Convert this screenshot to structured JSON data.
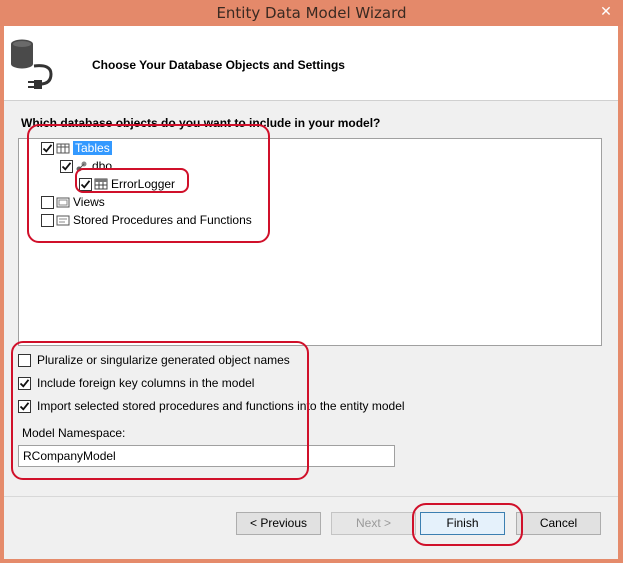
{
  "window": {
    "title": "Entity Data Model Wizard",
    "close_glyph": "✕"
  },
  "header": {
    "title": "Choose Your Database Objects and Settings",
    "icon": "database-plug-icon"
  },
  "question": "Which database objects do you want to include in your model?",
  "tree": {
    "tables": {
      "label": "Tables",
      "checked": true,
      "selected": true,
      "icon": "table-folder-icon"
    },
    "dbo": {
      "label": "dbo",
      "checked": true,
      "icon": "schema-icon"
    },
    "errorlogger": {
      "label": "ErrorLogger",
      "checked": true,
      "icon": "table-icon"
    },
    "views": {
      "label": "Views",
      "checked": false,
      "icon": "view-folder-icon"
    },
    "procs": {
      "label": "Stored Procedures and Functions",
      "checked": false,
      "icon": "procedure-folder-icon"
    }
  },
  "options": {
    "pluralize": {
      "label": "Pluralize or singularize generated object names",
      "checked": false
    },
    "foreign_keys": {
      "label": "Include foreign key columns in the model",
      "checked": true
    },
    "import_procs": {
      "label": "Import selected stored procedures and functions into the entity model",
      "checked": true
    }
  },
  "namespace": {
    "label": "Model Namespace:",
    "value": "RCompanyModel"
  },
  "buttons": {
    "previous": "< Previous",
    "next": "Next >",
    "finish": "Finish",
    "cancel": "Cancel"
  },
  "colors": {
    "annotation": "#d0102a",
    "selection": "#3399ff",
    "titlebar": "#e4896a"
  }
}
